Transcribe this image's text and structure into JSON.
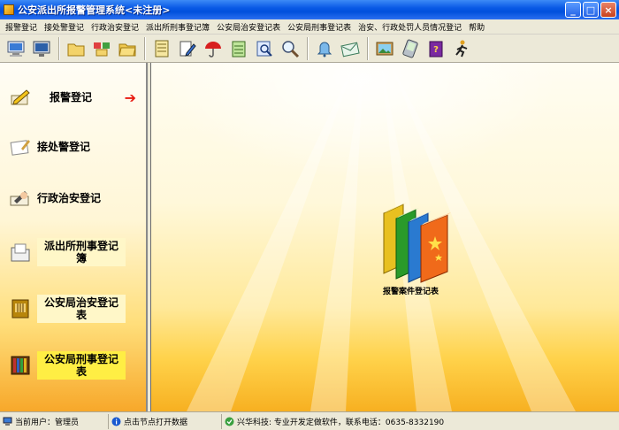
{
  "window": {
    "title": "公安派出所报警管理系统<未注册>",
    "minimize": "_",
    "maximize": "□",
    "close": "×"
  },
  "menu": [
    "报警登记",
    "接处警登记",
    "行政治安登记",
    "派出所刑事登记簿",
    "公安局治安登记表",
    "公安局刑事登记表",
    "治安、行政处罚人员情况登记",
    "帮助"
  ],
  "toolbar": {
    "icons": [
      "computer-icon",
      "monitor-icon",
      "folder-icon",
      "network-folder-icon",
      "folder-open-icon",
      "notebook-icon",
      "edit-document-icon",
      "umbrella-icon",
      "notepad-icon",
      "search-document-icon",
      "magnifier-icon",
      "bell-icon",
      "envelope-icon",
      "picture-icon",
      "pda-icon",
      "help-book-icon",
      "exit-runner-icon"
    ]
  },
  "sidebar": {
    "items": [
      {
        "label": "报警登记",
        "icon": "pencil-icon",
        "selected": true
      },
      {
        "label": "接处警登记",
        "icon": "note-icon",
        "selected": false
      },
      {
        "label": "行政治安登记",
        "icon": "writing-hand-icon",
        "selected": false
      },
      {
        "label": "派出所刑事登记簿",
        "icon": "document-folder-icon",
        "selected": false
      },
      {
        "label": "公安局治安登记表",
        "icon": "register-book-icon",
        "selected": false
      },
      {
        "label": "公安局刑事登记表",
        "icon": "bookshelf-icon",
        "selected": false
      }
    ],
    "arrow": "➔"
  },
  "main": {
    "feature_label": "报警案件登记表",
    "feature_icon": "books-icon"
  },
  "status": {
    "user": "当前用户：管理员",
    "hint": "点击节点打开数据",
    "company": "兴华科技: 专业开发定做软件，联系电话：0635-8332190"
  },
  "colors": {
    "title_bar": "#0a5ae6",
    "arrow": "#e81a10",
    "panel_gradient_bottom": "#f7a82a"
  }
}
